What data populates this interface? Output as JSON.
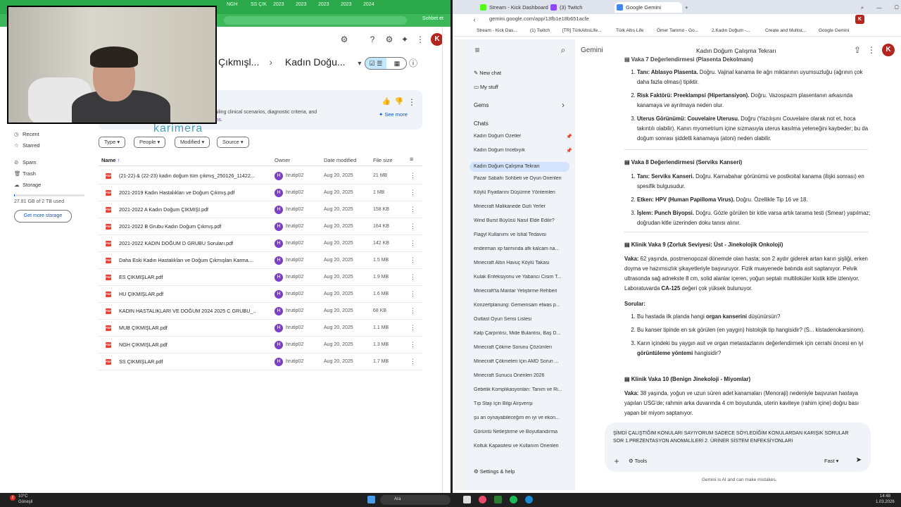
{
  "left_browser": {
    "tabs": [
      "NGH",
      "SS ÇIK",
      "2023",
      "2023",
      "2023",
      "2023",
      "2024"
    ],
    "extension_label": "Sohbet et",
    "avatar_initial": "K"
  },
  "drive": {
    "breadcrumbs": [
      "Çıkmışl...",
      "Kadın Doğu..."
    ],
    "view_toggle": [
      "☑ ☰",
      "▦"
    ],
    "banner_text_plain": "ns detailing clinical scenarios, diagnostic criteria, and",
    "banner_text_highlight": "onditions.",
    "see_more": "See more",
    "overlay_brand": "karimera",
    "sidebar": {
      "items": [
        {
          "icon": "clock-icon",
          "label": "Recent"
        },
        {
          "icon": "star-icon",
          "label": "Starred"
        },
        {
          "icon": "spam-icon",
          "label": "Spam"
        },
        {
          "icon": "trash-icon",
          "label": "Trash"
        },
        {
          "icon": "cloud-icon",
          "label": "Storage"
        }
      ],
      "storage_text": "27.81 GB of 2 TB used",
      "storage_fraction": 0.014,
      "get_storage": "Get more storage"
    },
    "filters": [
      "Type",
      "People",
      "Modified",
      "Source"
    ],
    "columns": {
      "name": "Name",
      "owner": "Owner",
      "date": "Date modified",
      "size": "File size"
    },
    "files": [
      {
        "name": "(21-22) & (22-23) kadın doğum tüm çıkmış_250126_11422...",
        "owner": "hrutip02",
        "date": "Aug 20, 2025",
        "size": "21 MB"
      },
      {
        "name": "2021-2019 Kadın Hastalıkları ve Doğum Çıkmış.pdf",
        "owner": "hrutip02",
        "date": "Aug 20, 2025",
        "size": "1 MB"
      },
      {
        "name": "2021-2022 A Kadın Doğum ÇIKMIŞI.pdf",
        "owner": "hrutip02",
        "date": "Aug 20, 2025",
        "size": "158 KB"
      },
      {
        "name": "2021-2022 B Grubu Kadın Doğum Çıkmış.pdf",
        "owner": "hrutip02",
        "date": "Aug 20, 2025",
        "size": "164 KB"
      },
      {
        "name": "2021-2022 KADIN DOĞUM D GRUBU Soruları.pdf",
        "owner": "hrutip02",
        "date": "Aug 20, 2025",
        "size": "142 KB"
      },
      {
        "name": "Daha Eski Kadın Hastalıkları ve Doğum Çıkmışları Karma....",
        "owner": "hrutip02",
        "date": "Aug 20, 2025",
        "size": "1.5 MB"
      },
      {
        "name": "ES ÇIKMIŞLAR.pdf",
        "owner": "hrutip02",
        "date": "Aug 20, 2025",
        "size": "1.9 MB"
      },
      {
        "name": "HU ÇIKMIŞLAR.pdf",
        "owner": "hrutip02",
        "date": "Aug 20, 2025",
        "size": "1.6 MB"
      },
      {
        "name": "KADIN HASTALIKLARI VE DOĞUM 2024 2025  C GRUBU_...",
        "owner": "hrutip02",
        "date": "Aug 20, 2025",
        "size": "68 KB"
      },
      {
        "name": "MUB ÇIKMIŞLAR.pdf",
        "owner": "hrutip02",
        "date": "Aug 20, 2025",
        "size": "1.1 MB"
      },
      {
        "name": "NGH ÇIKMIŞLAR.pdf",
        "owner": "hrutip02",
        "date": "Aug 20, 2025",
        "size": "1.3 MB"
      },
      {
        "name": "SS ÇIKMIŞLAR.pdf",
        "owner": "hrutip02",
        "date": "Aug 20, 2025",
        "size": "1.7 MB"
      }
    ]
  },
  "right_browser": {
    "tabs": [
      "Stream - Kick Dashboard",
      "(3) Twitch",
      "Google Gemini"
    ],
    "url": "gemini.google.com/app/13fb1e18b651acfe",
    "bookmarks": [
      "Stream - Kick Das...",
      "(1) Twitch",
      "[TR] TürkAltısLife...",
      "Türk Altıs Life",
      "Ömer Tammo - Go...",
      "2.Kadın Doğum -...",
      "Create and Multist...",
      "Google Gemini"
    ]
  },
  "gemini": {
    "brand": "Gemini",
    "chat_title": "Kadın Doğum Çalışma Tekrarı",
    "new_chat": "New chat",
    "my_stuff": "My stuff",
    "gems": "Gems",
    "chats_header": "Chats",
    "chats": [
      "Kadın Doğum Özetler",
      "Kadın Doğum İncebıyık",
      "Kadın Doğum Çalışma Tekrarı",
      "Pazar Sabahı Sohbeti ve Oyun Önerileri",
      "Köylü Fiyatlarını Düşürme Yöntemleri",
      "Minecraft Malikanede Gizli Yerler",
      "Wind Burst Büyüsü Nasıl Elde Edilir?",
      "Flagyl Kullanımı ve İshal Tedavisi",
      "enderman xp farmında afk kalcam na...",
      "Minecraft Altın Havuç Köylü Takası",
      "Kulak Enfeksiyonu ve Yabancı Cisim T...",
      "Minecraft'ta Mantar Yetiştirme Rehberi",
      "Konzertplanung: Gemeinsam etwas p...",
      "Outlast Oyun Serisi Listesi",
      "Kalp Çarpıntısı, Mide Bulantısı, Baş D...",
      "Minecraft Çökme Sorunu Çözümleri",
      "Minecraft Çökmeleri İçin AMD Sorun ...",
      "Minecraft Sunucu Önerileri 2026",
      "Gebelik Komplikasyonları: Tanım ve Ri...",
      "Tıp Stajı İçin Bilgi Alışverişi",
      "şu an oynayabileceğim en iyi ve ekon...",
      "Görüntü Netleştirme ve Boyutlandırma",
      "Koltuk Kapasitesi ve Kullanım Önerileri"
    ],
    "settings": "Settings & help",
    "block1": {
      "title": "Vaka 7 Değerlendirmesi (Plasenta Dekolmanı)",
      "items": [
        {
          "b": "Tanı: Ablasyo Plasenta.",
          "t": " Doğru. Vajinal kanama ile ağrı miktarının uyumsuzluğu (ağrının çok daha fazla olması) tipiktir."
        },
        {
          "b": "Risk Faktörü: Preeklampsi (Hipertansiyon).",
          "t": " Doğru. Vazospazm plasentanın arkasında kanamaya ve ayrılmaya neden olur."
        },
        {
          "b": "Uterus Görünümü: Couvelaire Uterusu.",
          "t": " Doğru (Yazılışını Couvelaire olarak not et, hoca takıntılı olabilir). Kanın myometrium içine sızmasıyla uterus kasılma yeteneğini kaybeder; bu da doğum sonrası şiddetli kanamaya (atoni) neden olabilir."
        }
      ]
    },
    "block2": {
      "title": "Vaka 8 Değerlendirmesi (Serviks Kanseri)",
      "items": [
        {
          "b": "Tanı: Serviks Kanseri.",
          "t": " Doğru. Karnabahar görünümü ve postkoital kanama (ilişki sonrası) en spesifik bulgusudur."
        },
        {
          "b": "Etken: HPV (Human Papilloma Virus).",
          "t": " Doğru. Özellikle Tip 16 ve 18."
        },
        {
          "b": "İşlem: Punch Biyopsi.",
          "t": " Doğru. Gözle görülen bir kitle varsa artık tarama testi (Smear) yapılmaz; doğrudan kitle üzerinden doku tanısı alınır."
        }
      ]
    },
    "block3": {
      "title": "Klinik Vaka 9 (Zorluk Seviyesi: Üst - Jinekolojik Onkoloji)",
      "case_label": "Vaka:",
      "case_text": " 62 yaşında, postmenopozal dönemde olan hasta; son 2 aydır giderek artan karın şişliği, erken doyma ve hazımsızlık şikayetleriyle başvuruyor. Fizik muayenede batında asit saptanıyor. Pelvik ultrasonda sağ adnekste 8 cm, solid alanlar içeren, yoğun septalı multiloküler kistik kitle izleniyor. Laboratuvarda",
      "case_bold": " CA-125",
      "case_tail": " değeri çok yüksek bulunuyor.",
      "questions_label": "Sorular:",
      "questions": [
        {
          "a": "Bu hastada ilk planda hangi ",
          "b": "organ kanserini",
          "c": " düşünürsün?"
        },
        {
          "a": "Bu kanser tipinde en sık görülen (en yaygın) histolojik tip hangisidir? (S...",
          "b": "",
          "c": " kistadenokarsinom)."
        },
        {
          "a": "Karın içindeki bu yaygın asit ve organ metastazlarını değerlendirmek için cerrahi öncesi en iyi ",
          "b": "görüntüleme yöntemi",
          "c": " hangisidir?"
        }
      ]
    },
    "block4": {
      "title": "Klinik Vaka 10 (Benign Jinekoloji - Miyomlar)",
      "case_label": "Vaka:",
      "case_text": " 38 yaşında, yoğun ve uzun süren adet kanamaları (Menoraji) nedeniyle başvuran hastaya yapılan USG'de; rahmin arka duvarında 4 cm boyutunda, uterin kaviteye (rahim içine) doğru bası yapan bir miyom saptanıyor."
    },
    "prompt_text": "ŞİMDİ ÇALIŞTIĞIM KONULARI SAYIYORUM SADECE SÖYLEDİĞİM KONULARDAN KARIŞIK SORULAR SOR 1.PREZENTASYON ANOMALİLERİ 2. ÜRİNER SİSTEM ENFEKSİYONLARI",
    "tools_label": "Tools",
    "model_label": "Fast",
    "disclaimer": "Gemini is AI and can make mistakes."
  },
  "taskbar": {
    "weather_temp": "10°C",
    "weather_desc": "Güneşli",
    "search_label": "Ara",
    "time": "14:48",
    "date": "1.03.2026",
    "badge": "2"
  },
  "colors": {
    "gemini_active": "#d3e3fd",
    "drive_pdf": "#ea4335",
    "owner_avatar": "#7b3fbf",
    "left_chrome": "#2aa84a"
  }
}
